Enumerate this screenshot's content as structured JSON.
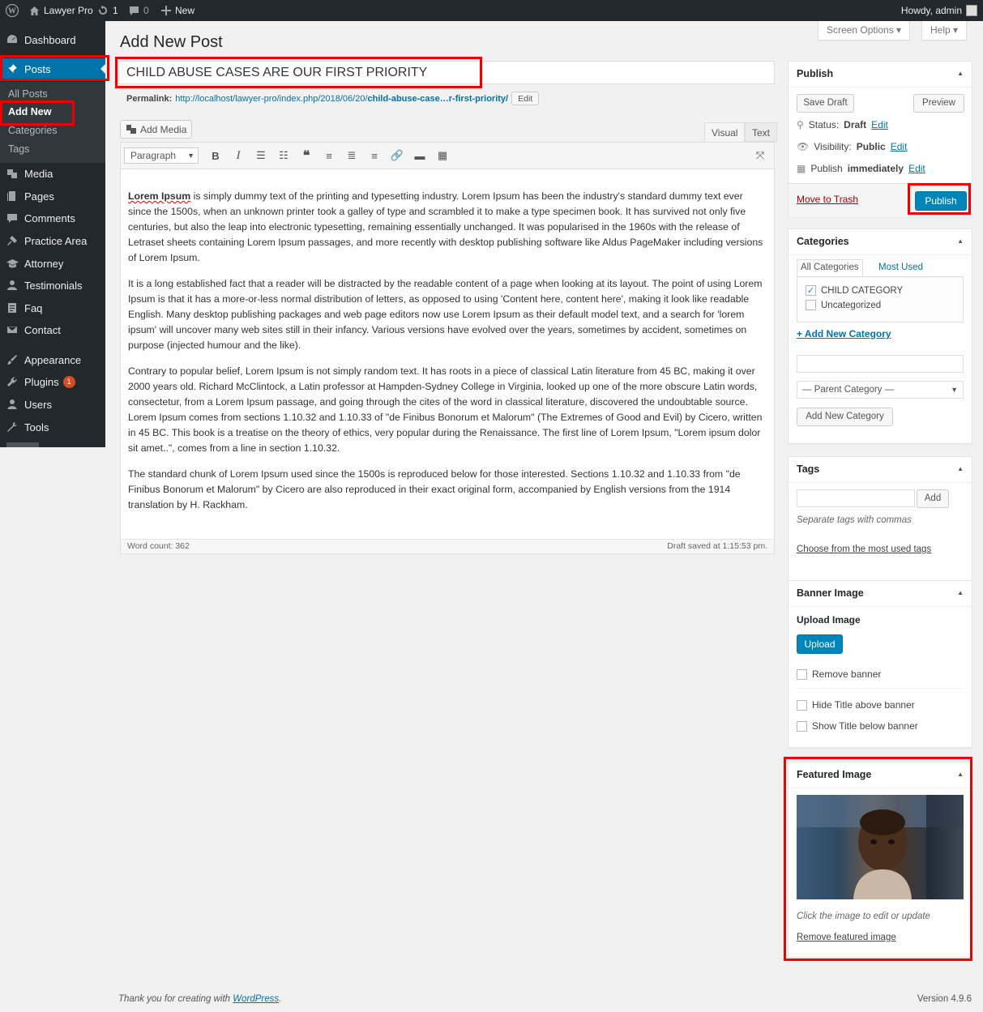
{
  "adminbar": {
    "site": "Lawyer Pro",
    "updates": "1",
    "comments": "0",
    "new": "New",
    "howdy": "Howdy, admin"
  },
  "sidebar": {
    "items": [
      {
        "label": "Dashboard",
        "icon": "dashboard-icon"
      },
      {
        "label": "Posts",
        "icon": "pin-icon"
      },
      {
        "label": "Media",
        "icon": "media-icon"
      },
      {
        "label": "Pages",
        "icon": "pages-icon"
      },
      {
        "label": "Comments",
        "icon": "comments-icon"
      },
      {
        "label": "Practice Area",
        "icon": "hammer-icon"
      },
      {
        "label": "Attorney",
        "icon": "graduation-icon"
      },
      {
        "label": "Testimonials",
        "icon": "users-icon"
      },
      {
        "label": "Faq",
        "icon": "document-icon"
      },
      {
        "label": "Contact",
        "icon": "mail-icon"
      },
      {
        "label": "Appearance",
        "icon": "brush-icon"
      },
      {
        "label": "Plugins",
        "icon": "plugin-icon",
        "badge": "1"
      },
      {
        "label": "Users",
        "icon": "user-icon"
      },
      {
        "label": "Tools",
        "icon": "wrench-icon"
      }
    ],
    "posts_sub": [
      "All Posts",
      "Add New",
      "Categories",
      "Tags"
    ]
  },
  "header": {
    "screen_options": "Screen Options ▾",
    "help": "Help ▾",
    "title": "Add New Post"
  },
  "post": {
    "title": "CHILD ABUSE CASES ARE OUR FIRST PRIORITY",
    "permalink_label": "Permalink:",
    "permalink_base": "http://localhost/lawyer-pro/index.php/2018/06/20/",
    "permalink_slug": "child-abuse-case…r-first-priority/",
    "edit": "Edit"
  },
  "editor": {
    "add_media": "Add Media",
    "tab_visual": "Visual",
    "tab_text": "Text",
    "format": "Paragraph",
    "p1_lead": "Lorem Ipsum",
    "p1": " is simply dummy text of the printing and typesetting industry. Lorem Ipsum has been the industry's standard dummy text ever since the 1500s, when an unknown printer took a galley of type and scrambled it to make a type specimen book. It has survived not only five centuries, but also the leap into electronic typesetting, remaining essentially unchanged. It was popularised in the 1960s with the release of Letraset sheets containing Lorem Ipsum passages, and more recently with desktop publishing software like Aldus PageMaker including versions of Lorem Ipsum.",
    "p2": "It is a long established fact that a reader will be distracted by the readable content of a page when looking at its layout. The point of using Lorem Ipsum is that it has a more-or-less normal distribution of letters, as opposed to using 'Content here, content here', making it look like readable English. Many desktop publishing packages and web page editors now use Lorem Ipsum as their default model text, and a search for 'lorem ipsum' will uncover many web sites still in their infancy. Various versions have evolved over the years, sometimes by accident, sometimes on purpose (injected humour and the like).",
    "p3": "Contrary to popular belief, Lorem Ipsum is not simply random text. It has roots in a piece of classical Latin literature from 45 BC, making it over 2000 years old. Richard McClintock, a Latin professor at Hampden-Sydney College in Virginia, looked up one of the more obscure Latin words, consectetur, from a Lorem Ipsum passage, and going through the cites of the word in classical literature, discovered the undoubtable source. Lorem Ipsum comes from sections 1.10.32 and 1.10.33 of \"de Finibus Bonorum et Malorum\" (The Extremes of Good and Evil) by Cicero, written in 45 BC. This book is a treatise on the theory of ethics, very popular during the Renaissance. The first line of Lorem Ipsum, \"Lorem ipsum dolor sit amet..\", comes from a line in section 1.10.32.",
    "p4": "The standard chunk of Lorem Ipsum used since the 1500s is reproduced below for those interested. Sections 1.10.32 and 1.10.33 from \"de Finibus Bonorum et Malorum\" by Cicero are also reproduced in their exact original form, accompanied by English versions from the 1914 translation by H. Rackham.",
    "word_count": "Word count: 362",
    "draft_saved": "Draft saved at 1:15:53 pm."
  },
  "publish": {
    "title": "Publish",
    "save_draft": "Save Draft",
    "preview": "Preview",
    "status_label": "Status:",
    "status": "Draft",
    "visibility_label": "Visibility:",
    "visibility": "Public",
    "publish_label": "Publish",
    "publish_when": "immediately",
    "edit": "Edit",
    "trash": "Move to Trash",
    "publish_btn": "Publish"
  },
  "categories": {
    "title": "Categories",
    "tab_all": "All Categories",
    "tab_used": "Most Used",
    "items": [
      "CHILD CATEGORY",
      "Uncategorized"
    ],
    "add_link": "+ Add New Category",
    "parent": "— Parent Category —",
    "add_btn": "Add New Category"
  },
  "tags": {
    "title": "Tags",
    "add": "Add",
    "hint": "Separate tags with commas",
    "choose": "Choose from the most used tags"
  },
  "banner": {
    "title": "Banner Image",
    "upload_label": "Upload Image",
    "upload_btn": "Upload",
    "remove": "Remove banner",
    "hide_title": "Hide Title above banner",
    "show_title": "Show Title below banner"
  },
  "featured": {
    "title": "Featured Image",
    "hint": "Click the image to edit or update",
    "remove": "Remove featured image"
  },
  "footer": {
    "thanks": "Thank you for creating with ",
    "wp": "WordPress",
    "dot": ".",
    "version": "Version 4.9.6"
  },
  "colors": {
    "accent": "#0073aa",
    "highlight": "#e00000",
    "sidebar": "#23282d"
  }
}
